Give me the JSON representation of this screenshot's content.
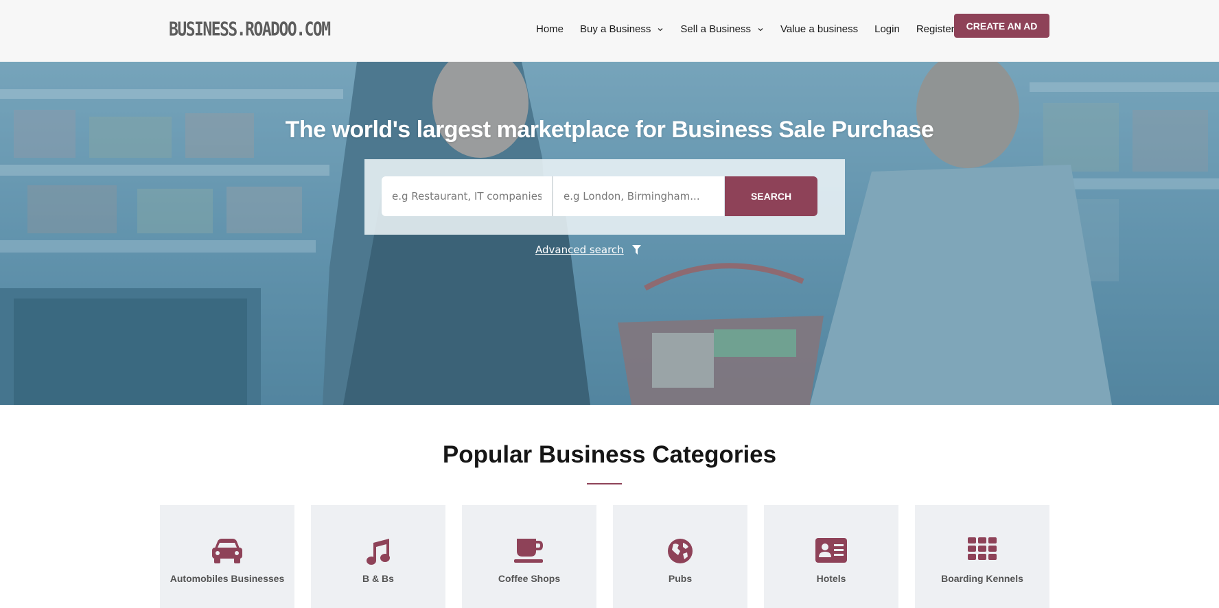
{
  "brand": {
    "logo_text": "BUSINESS.ROADOO.COM",
    "accent_color": "#8e4258"
  },
  "nav": {
    "items": [
      {
        "label": "Home",
        "has_dropdown": false
      },
      {
        "label": "Buy a Business",
        "has_dropdown": true
      },
      {
        "label": "Sell a Business",
        "has_dropdown": true
      },
      {
        "label": "Value a business",
        "has_dropdown": false
      },
      {
        "label": "Login",
        "has_dropdown": false
      },
      {
        "label": "Register",
        "has_dropdown": false
      }
    ],
    "cta_label": "CREATE AN AD"
  },
  "hero": {
    "title": "The world's largest marketplace for Business Sale Purchase",
    "search": {
      "what_placeholder": "e.g Restaurant, IT companies..",
      "where_placeholder": "e.g London, Birmingham...",
      "button_label": "SEARCH"
    },
    "advanced_search_label": "Advanced search",
    "advanced_search_icon": "filter-icon"
  },
  "categories": {
    "title": "Popular Business Categories",
    "items": [
      {
        "label": "Automobiles Businesses",
        "icon": "car-icon"
      },
      {
        "label": "B & Bs",
        "icon": "music-icon"
      },
      {
        "label": "Coffee Shops",
        "icon": "coffee-icon"
      },
      {
        "label": "Pubs",
        "icon": "globe-icon"
      },
      {
        "label": "Hotels",
        "icon": "id-card-icon"
      },
      {
        "label": "Boarding Kennels",
        "icon": "grid-icon"
      }
    ]
  }
}
